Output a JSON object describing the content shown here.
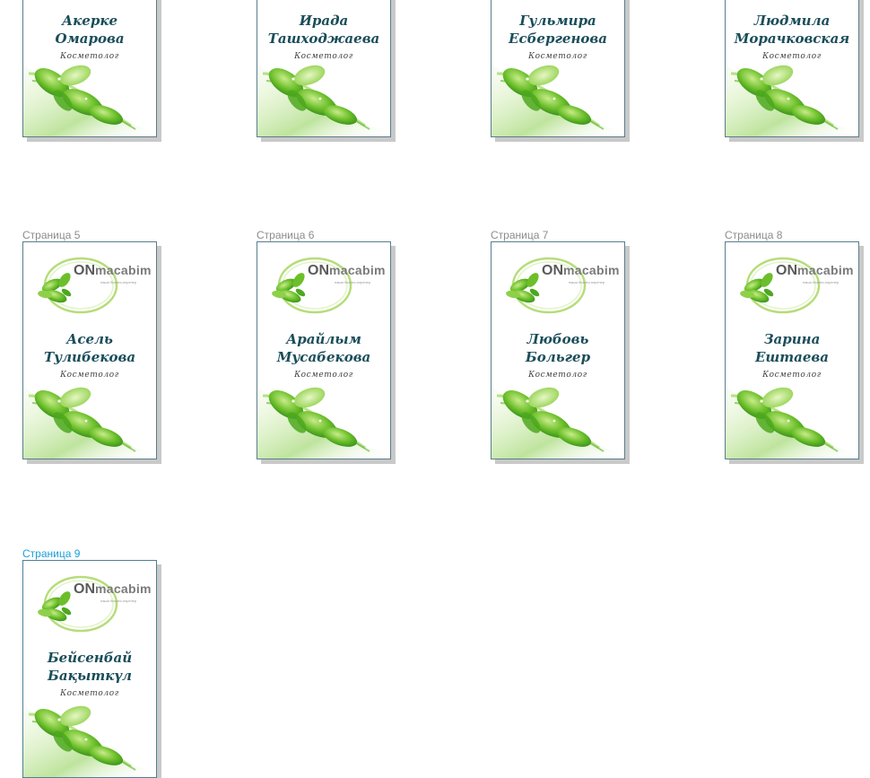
{
  "role_label": "Косметолог",
  "logo": {
    "on": "ON",
    "brand": "macabim",
    "tagline": "наши бизнес-партнер"
  },
  "colors": {
    "name": "#1a4d5a",
    "accent_label": "#1aa0d8",
    "leaf": "#6cbf2a"
  },
  "pages": [
    {
      "label": "",
      "name_line1": "Акерке",
      "name_line2": "Омарова",
      "has_logo": false
    },
    {
      "label": "",
      "name_line1": "Ирада",
      "name_line2": "Ташходжаева",
      "has_logo": false
    },
    {
      "label": "",
      "name_line1": "Гульмира",
      "name_line2": "Есбергенова",
      "has_logo": false
    },
    {
      "label": "",
      "name_line1": "Людмила",
      "name_line2": "Морачковская",
      "has_logo": false
    },
    {
      "label": "Страница 5",
      "name_line1": "Асель",
      "name_line2": "Тулибекова",
      "has_logo": true
    },
    {
      "label": "Страница 6",
      "name_line1": "Арайлым",
      "name_line2": "Мусабекова",
      "has_logo": true
    },
    {
      "label": "Страница 7",
      "name_line1": "Любовь",
      "name_line2": "Больгер",
      "has_logo": true
    },
    {
      "label": "Страница 8",
      "name_line1": "Зарина",
      "name_line2": "Ештаева",
      "has_logo": true
    },
    {
      "label": "Страница 9",
      "name_line1": "Бейсенбай",
      "name_line2": "Бақыткүл",
      "has_logo": true,
      "active": true
    }
  ]
}
